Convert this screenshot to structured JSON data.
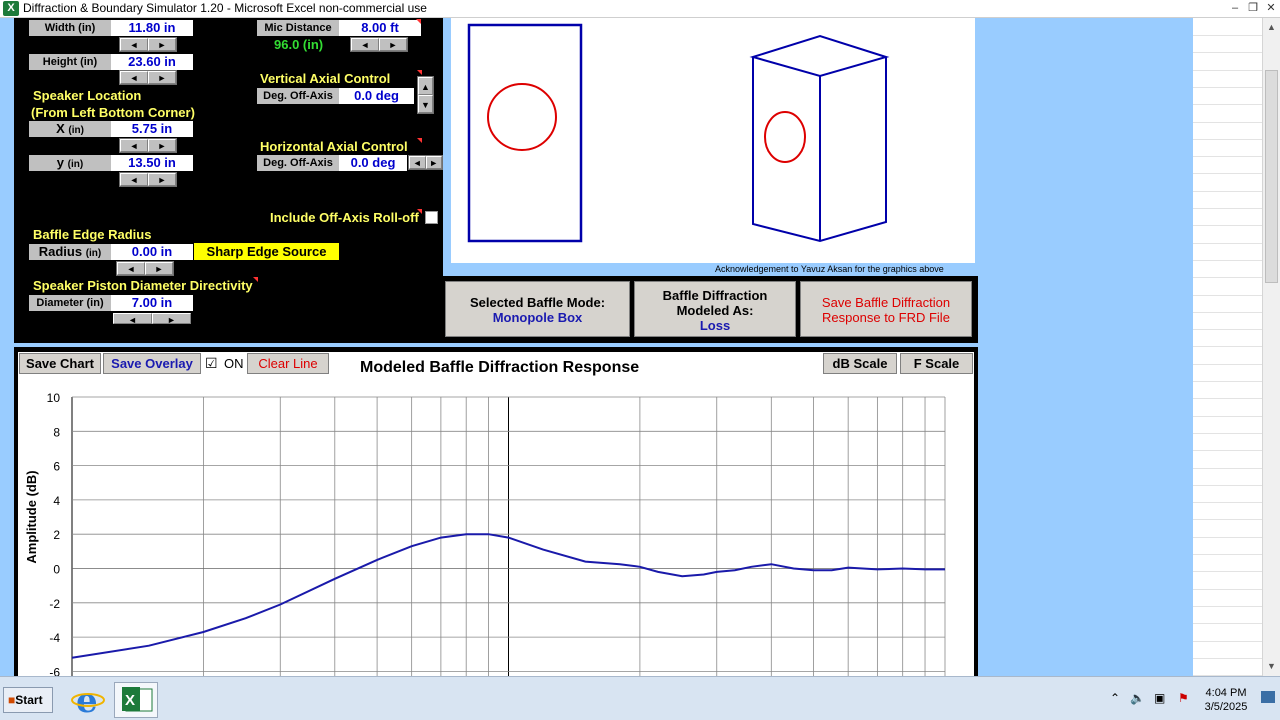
{
  "window": {
    "title": "Diffraction & Boundary Simulator 1.20 - Microsoft Excel non-commercial use",
    "app_icon": "X",
    "minimize": "–",
    "restore": "❐",
    "close": "✕"
  },
  "panel": {
    "width_label": "Width (in)",
    "width_value": "11.80 in",
    "height_label": "Height (in)",
    "height_value": "23.60 in",
    "speaker_location_title": "Speaker Location",
    "speaker_location_sub": "(From Left Bottom Corner)",
    "x_label": "X",
    "x_unit": "(in)",
    "x_value": "5.75 in",
    "y_label": "y",
    "y_unit": "(in)",
    "y_value": "13.50 in",
    "mic_label": "Mic Distance",
    "mic_value": "8.00 ft",
    "mic_in": "96.0 (in)",
    "vertical_title": "Vertical Axial Control",
    "vertical_label": "Deg. Off-Axis",
    "vertical_value": "0.0 deg",
    "horizontal_title": "Horizontal Axial Control",
    "horizontal_label": "Deg. Off-Axis",
    "horizontal_value": "0.0 deg",
    "rolloff_label": "Include Off-Axis Roll-off",
    "edge_title": "Baffle Edge Radius",
    "radius_label": "Radius",
    "radius_unit": "(in)",
    "radius_value": "0.00 in",
    "edge_source": "Sharp Edge Source",
    "piston_title": "Speaker Piston Diameter Directivity",
    "diameter_label": "Diameter (in)",
    "diameter_value": "7.00 in",
    "left_arrow": "◄",
    "right_arrow": "►",
    "up_arrow": "▲",
    "down_arrow": "▼"
  },
  "graphics": {
    "acknowledgement": "Acknowledgement to Yavuz Aksan for the graphics above"
  },
  "modes": {
    "selected_title": "Selected Baffle Mode:",
    "selected_value": "Monopole Box",
    "modeled_title_1": "Baffle Diffraction",
    "modeled_title_2": "Modeled As:",
    "modeled_value": "Loss",
    "save_frd_1": "Save Baffle Diffraction",
    "save_frd_2": "Response to FRD File"
  },
  "chart_toolbar": {
    "save_chart": "Save Chart",
    "save_overlay": "Save Overlay",
    "on_label": "ON",
    "on_checked": "☑",
    "clear_line": "Clear Line",
    "db_scale": "dB Scale",
    "f_scale": "F Scale"
  },
  "chart_data": {
    "type": "line",
    "title": "Modeled Baffle Diffraction Response",
    "xlabel": "",
    "ylabel": "Amplitude (dB)",
    "ylim": [
      -6,
      10
    ],
    "x_scale": "log",
    "xlim": [
      100,
      10000
    ],
    "yticks": [
      10,
      8,
      6,
      4,
      2,
      0,
      -2,
      -4,
      -6
    ],
    "grid": true,
    "line_color": "#1a1aaa",
    "series": [
      {
        "x": [
          100,
          150,
          200,
          250,
          300,
          400,
          500,
          600,
          700,
          800,
          900,
          1000,
          1200,
          1500,
          1800,
          2000,
          2200,
          2500,
          2800,
          3000,
          3300,
          3600,
          4000,
          4500,
          5000,
          5500,
          6000,
          7000,
          8000,
          9000,
          10000
        ],
        "values": [
          -5.2,
          -4.5,
          -3.7,
          -2.9,
          -2.1,
          -0.6,
          0.5,
          1.3,
          1.8,
          2.0,
          2.0,
          1.8,
          1.1,
          0.4,
          0.25,
          0.1,
          -0.2,
          -0.45,
          -0.35,
          -0.2,
          -0.1,
          0.1,
          0.25,
          0.0,
          -0.1,
          -0.1,
          0.05,
          -0.05,
          0.0,
          -0.05,
          -0.05
        ]
      }
    ]
  },
  "taskbar": {
    "start": "Start",
    "time": "4:04 PM",
    "date": "3/5/2025",
    "tray_chevron": "⌃"
  }
}
